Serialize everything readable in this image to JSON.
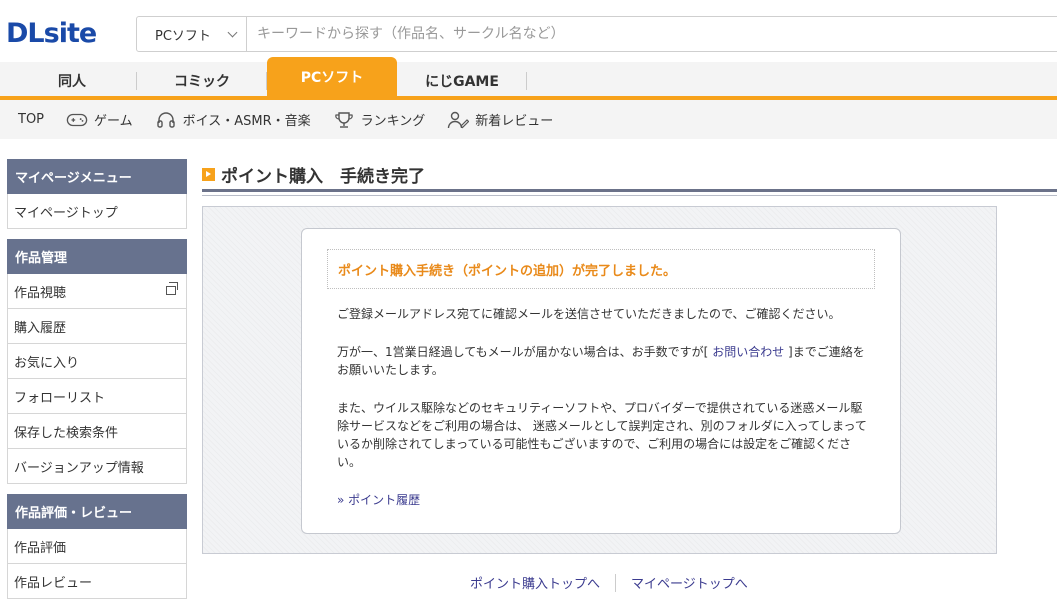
{
  "header": {
    "logo": "DLsite",
    "search": {
      "category": "PCソフト",
      "placeholder": "キーワードから探す（作品名、サークル名など）"
    }
  },
  "category_tabs": [
    {
      "label": "同人"
    },
    {
      "label": "コミック"
    },
    {
      "label": "PCソフト",
      "active": true
    },
    {
      "label": "にじGAME"
    }
  ],
  "sub_nav": [
    {
      "label": "TOP",
      "icon": ""
    },
    {
      "label": "ゲーム",
      "icon": "gamepad-icon"
    },
    {
      "label": "ボイス・ASMR・音楽",
      "icon": "headphones-icon"
    },
    {
      "label": "ランキング",
      "icon": "trophy-icon"
    },
    {
      "label": "新着レビュー",
      "icon": "user-pen-icon"
    }
  ],
  "sidebar": {
    "sections": [
      {
        "title": "マイページメニュー",
        "items": [
          {
            "label": "マイページトップ"
          }
        ]
      },
      {
        "title": "作品管理",
        "items": [
          {
            "label": "作品視聴",
            "external": true
          },
          {
            "label": "購入履歴"
          },
          {
            "label": "お気に入り"
          },
          {
            "label": "フォローリスト"
          },
          {
            "label": "保存した検索条件"
          },
          {
            "label": "バージョンアップ情報"
          }
        ]
      },
      {
        "title": "作品評価・レビュー",
        "items": [
          {
            "label": "作品評価"
          },
          {
            "label": "作品レビュー"
          }
        ]
      }
    ]
  },
  "main": {
    "title": "ポイント購入　手続き完了",
    "complete_message": "ポイント購入手続き（ポイントの追加）が完了しました。",
    "para1": "ご登録メールアドレス宛てに確認メールを送信させていただきましたので、ご確認ください。",
    "para2_a": "万が一、1営業日経過してもメールが届かない場合は、お手数ですが[ ",
    "para2_link": "お問い合わせ",
    "para2_b": " ]までご連絡をお願いいたします。",
    "para3": "また、ウイルス駆除などのセキュリティーソフトや、プロバイダーで提供されている迷惑メール駆除サービスなどをご利用の場合は、 迷惑メールとして誤判定され、別のフォルダに入ってしまっているか削除されてしまっている可能性もございますので、ご利用の場合には設定をご確認ください。",
    "history_link": "» ポイント履歴",
    "bottom_links": [
      "ポイント購入トップへ",
      "マイページトップへ"
    ]
  },
  "colors": {
    "accent_orange": "#f7a21b",
    "sidebar_header": "#67728e",
    "logo_blue": "#1a4aa8",
    "link": "#3b3b8f",
    "complete_text": "#e98a1a"
  }
}
